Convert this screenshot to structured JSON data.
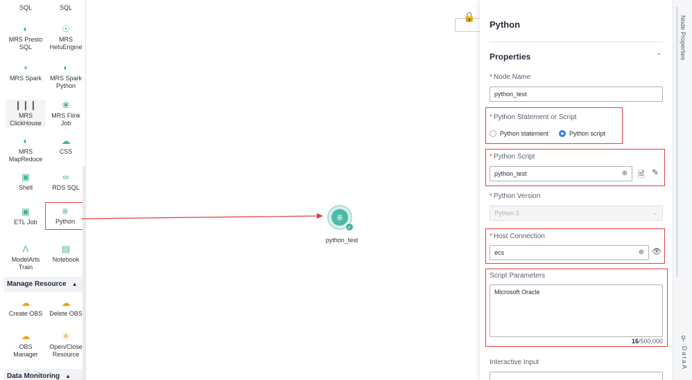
{
  "palette": {
    "items": [
      {
        "label": "SQL",
        "icon": "sql-icon"
      },
      {
        "label": "SQL",
        "icon": "sql-icon"
      },
      {
        "label": "MRS Presto\nSQL",
        "icon": "presto-icon"
      },
      {
        "label": "MRS\nHetuEngine",
        "icon": "hetu-icon"
      },
      {
        "label": "MRS Spark",
        "icon": "spark-icon"
      },
      {
        "label": "MRS Spark\nPython",
        "icon": "spark-python-icon"
      },
      {
        "label": "MRS\nClickHouse",
        "icon": "clickhouse-icon"
      },
      {
        "label": "MRS Flink\nJob",
        "icon": "flink-icon"
      },
      {
        "label": "MRS\nMapReduce",
        "icon": "mapreduce-icon"
      },
      {
        "label": "CSS",
        "icon": "css-icon"
      },
      {
        "label": "Shell",
        "icon": "shell-icon"
      },
      {
        "label": "RDS SQL",
        "icon": "rds-icon"
      },
      {
        "label": "ETL Job",
        "icon": "etl-icon"
      },
      {
        "label": "Python",
        "icon": "python-icon"
      },
      {
        "label": "ModelArts\nTrain",
        "icon": "modelarts-icon"
      },
      {
        "label": "Notebook",
        "icon": "notebook-icon"
      },
      {
        "label": "Create OBS",
        "icon": "create-obs-icon"
      },
      {
        "label": "Delete OBS",
        "icon": "delete-obs-icon"
      },
      {
        "label": "OBS\nManager",
        "icon": "obs-manager-icon"
      },
      {
        "label": "Open/Close\nResource",
        "icon": "open-close-resource-icon"
      }
    ],
    "sections": {
      "manage_resource": "Manage Resource",
      "data_monitoring": "Data Monitoring"
    }
  },
  "canvas": {
    "node_label": "python_test"
  },
  "panel": {
    "title": "Python",
    "properties": "Properties",
    "node_name_label": "Node Name",
    "node_name_value": "python_test",
    "statement_label": "Python Statement or Script",
    "radio_statement": "Python statement",
    "radio_script": "Python script",
    "script_label": "Python Script",
    "script_value": "python_test",
    "version_label": "Python Version",
    "version_value": "Python 3",
    "host_label": "Host Connection",
    "host_value": "ecs",
    "params_label": "Script Parameters",
    "params_value": "Microsoft Oracle",
    "counter_used": "16",
    "counter_total": "/500,000",
    "interactive_label": "Interactive Input"
  },
  "rail": {
    "node_properties": "Node Properties",
    "bottom_text": "DataA"
  },
  "colors": {
    "accent": "#47b39b",
    "highlight": "#e03e3e",
    "radio_on": "#2b7de9"
  }
}
